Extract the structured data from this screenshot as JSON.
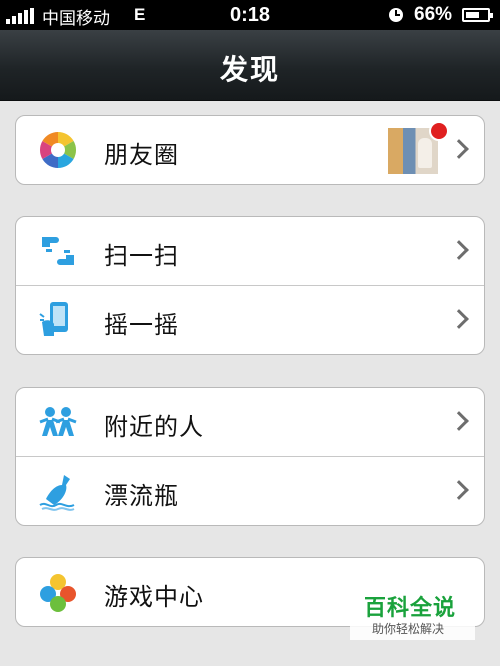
{
  "status_bar": {
    "carrier": "中国移动",
    "network": "E",
    "time": "0:18",
    "battery": "66%",
    "battery_level": 0.66
  },
  "nav": {
    "title": "发现"
  },
  "groups": [
    {
      "items": [
        {
          "label": "朋友圈",
          "icon": "moments-aperture-icon"
        }
      ]
    },
    {
      "items": [
        {
          "label": "扫一扫",
          "icon": "scan-hands-icon"
        },
        {
          "label": "摇一摇",
          "icon": "shake-phone-icon"
        }
      ]
    },
    {
      "items": [
        {
          "label": "附近的人",
          "icon": "people-nearby-icon"
        },
        {
          "label": "漂流瓶",
          "icon": "drift-bottle-icon"
        }
      ]
    },
    {
      "items": [
        {
          "label": "游戏中心",
          "icon": "game-center-icon"
        }
      ]
    }
  ],
  "watermark": {
    "title": "百科全说",
    "subtitle": "助你轻松解决"
  }
}
